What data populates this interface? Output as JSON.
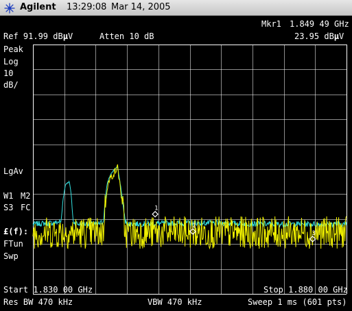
{
  "title_bar": {
    "brand": "Agilent",
    "time": "13:29:08",
    "date": "Mar 14, 2005",
    "logo_icon": "agilent-spark-icon"
  },
  "header": {
    "ref_level": "Ref 91.99 dB",
    "ref_unit_mu": "µ",
    "ref_unit_v": "V",
    "atten": "Atten 10 dB",
    "marker_label": "Mkr1",
    "marker_freq": "1.849 49 GHz",
    "marker_amp": "23.95 dB",
    "marker_amp_mu": "µ",
    "marker_amp_v": "V"
  },
  "left_panel": {
    "detector": "Peak",
    "scale_type": "Log",
    "scale_value": "10",
    "scale_unit": "dB/",
    "avg_type": "LgAv",
    "trace_w1": "W1",
    "trace_m2": "M2",
    "trace_s3": "S3",
    "trace_fc": "FC",
    "func_f": "£(f):",
    "func_ftun": "FTun",
    "func_swp": "Swp"
  },
  "footer": {
    "start": "Start 1.830 00 GHz",
    "stop": "Stop 1.880 00 GHz",
    "res_bw": "Res BW 470 kHz",
    "vbw": "VBW 470 kHz",
    "sweep": "Sweep 1 ms (601 pts)"
  },
  "markers": [
    "1",
    "2",
    "3"
  ],
  "colors": {
    "grid": "#ffffff",
    "trace_cyan": "#33e0e0",
    "trace_yellow": "#f0f000",
    "background": "#000000"
  },
  "chart_data": {
    "type": "line",
    "x_range": [
      1.83,
      1.88
    ],
    "x_unit": "GHz",
    "y_top": 91.99,
    "y_unit": "dBµV",
    "y_scale": "10 dB/",
    "points": 601,
    "grid": true,
    "series": [
      {
        "color": "#33e0e0",
        "x": [
          1.83,
          1.8335,
          1.8345,
          1.8348,
          1.8352,
          1.8358,
          1.8361,
          1.8364,
          1.8372,
          1.8405,
          1.8412,
          1.8418,
          1.8424,
          1.843,
          1.8435,
          1.844,
          1.8447,
          1.8452,
          1.856,
          1.868,
          1.88
        ],
        "y": [
          20,
          20.5,
          21,
          30,
          36,
          37,
          32,
          21,
          20,
          20,
          21,
          36,
          40,
          42,
          43,
          35,
          21,
          20,
          20.5,
          20,
          20
        ]
      },
      {
        "color": "#f0f000",
        "x": [
          1.83,
          1.8335,
          1.8345,
          1.8348,
          1.8352,
          1.8358,
          1.8361,
          1.8364,
          1.8372,
          1.8405,
          1.8412,
          1.8418,
          1.8424,
          1.843,
          1.8435,
          1.844,
          1.8447,
          1.8452,
          1.856,
          1.868,
          1.88
        ],
        "y": [
          14,
          14,
          14,
          14,
          14,
          14,
          14,
          14,
          14,
          14,
          14,
          34,
          38,
          40,
          42,
          33,
          14,
          14,
          14,
          14,
          14
        ]
      }
    ],
    "marker_points": [
      {
        "label": "1",
        "x": 1.84949,
        "y": 23.95
      },
      {
        "label": "2",
        "x": 1.8555,
        "y": 17
      },
      {
        "label": "3",
        "x": 1.8746,
        "y": 14
      }
    ]
  }
}
